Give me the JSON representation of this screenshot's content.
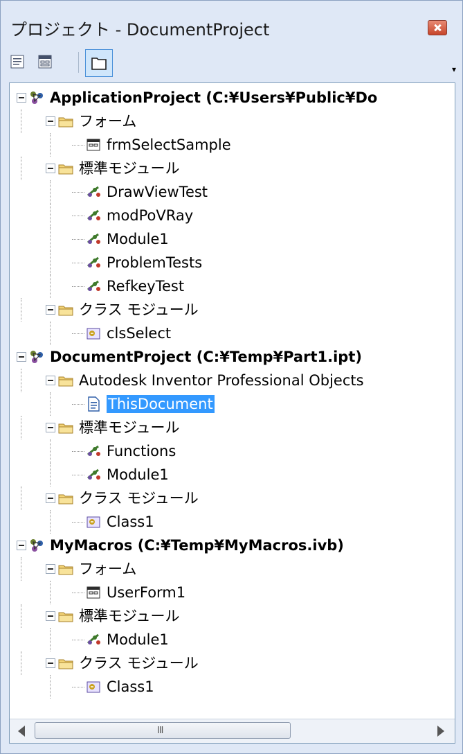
{
  "window": {
    "title": "プロジェクト - DocumentProject"
  },
  "toolbar": {
    "buttons": [
      {
        "name": "view-code-button",
        "icon": "view-code-icon"
      },
      {
        "name": "view-object-button",
        "icon": "view-object-icon"
      },
      {
        "name": "toggle-folders-button",
        "icon": "folder-icon"
      }
    ],
    "dropdown_glyph": "▾"
  },
  "tree": [
    {
      "level": 0,
      "type": "project",
      "label": "ApplicationProject (C:¥Users¥Public¥Do"
    },
    {
      "level": 1,
      "type": "folder",
      "label": "フォーム"
    },
    {
      "level": 2,
      "type": "form",
      "label": "frmSelectSample"
    },
    {
      "level": 1,
      "type": "folder",
      "label": "標準モジュール"
    },
    {
      "level": 2,
      "type": "module",
      "label": "DrawViewTest"
    },
    {
      "level": 2,
      "type": "module",
      "label": "modPoVRay"
    },
    {
      "level": 2,
      "type": "module",
      "label": "Module1"
    },
    {
      "level": 2,
      "type": "module",
      "label": "ProblemTests"
    },
    {
      "level": 2,
      "type": "module",
      "label": "RefkeyTest"
    },
    {
      "level": 1,
      "type": "folder",
      "label": "クラス モジュール"
    },
    {
      "level": 2,
      "type": "class",
      "label": "clsSelect"
    },
    {
      "level": 0,
      "type": "project",
      "label": "DocumentProject (C:¥Temp¥Part1.ipt)"
    },
    {
      "level": 1,
      "type": "folder",
      "label": "Autodesk Inventor Professional Objects"
    },
    {
      "level": 2,
      "type": "document",
      "label": "ThisDocument",
      "selected": true
    },
    {
      "level": 1,
      "type": "folder",
      "label": "標準モジュール"
    },
    {
      "level": 2,
      "type": "module",
      "label": "Functions"
    },
    {
      "level": 2,
      "type": "module",
      "label": "Module1"
    },
    {
      "level": 1,
      "type": "folder",
      "label": "クラス モジュール"
    },
    {
      "level": 2,
      "type": "class",
      "label": "Class1"
    },
    {
      "level": 0,
      "type": "project",
      "label": "MyMacros (C:¥Temp¥MyMacros.ivb)"
    },
    {
      "level": 1,
      "type": "folder",
      "label": "フォーム"
    },
    {
      "level": 2,
      "type": "form",
      "label": "UserForm1"
    },
    {
      "level": 1,
      "type": "folder",
      "label": "標準モジュール"
    },
    {
      "level": 2,
      "type": "module",
      "label": "Module1"
    },
    {
      "level": 1,
      "type": "folder",
      "label": "クラス モジュール"
    },
    {
      "level": 2,
      "type": "class",
      "label": "Class1"
    }
  ],
  "scrollbar": {
    "thumb_grip": "III"
  },
  "colors": {
    "selection": "#3399ff",
    "frame": "#dfe8f6"
  }
}
